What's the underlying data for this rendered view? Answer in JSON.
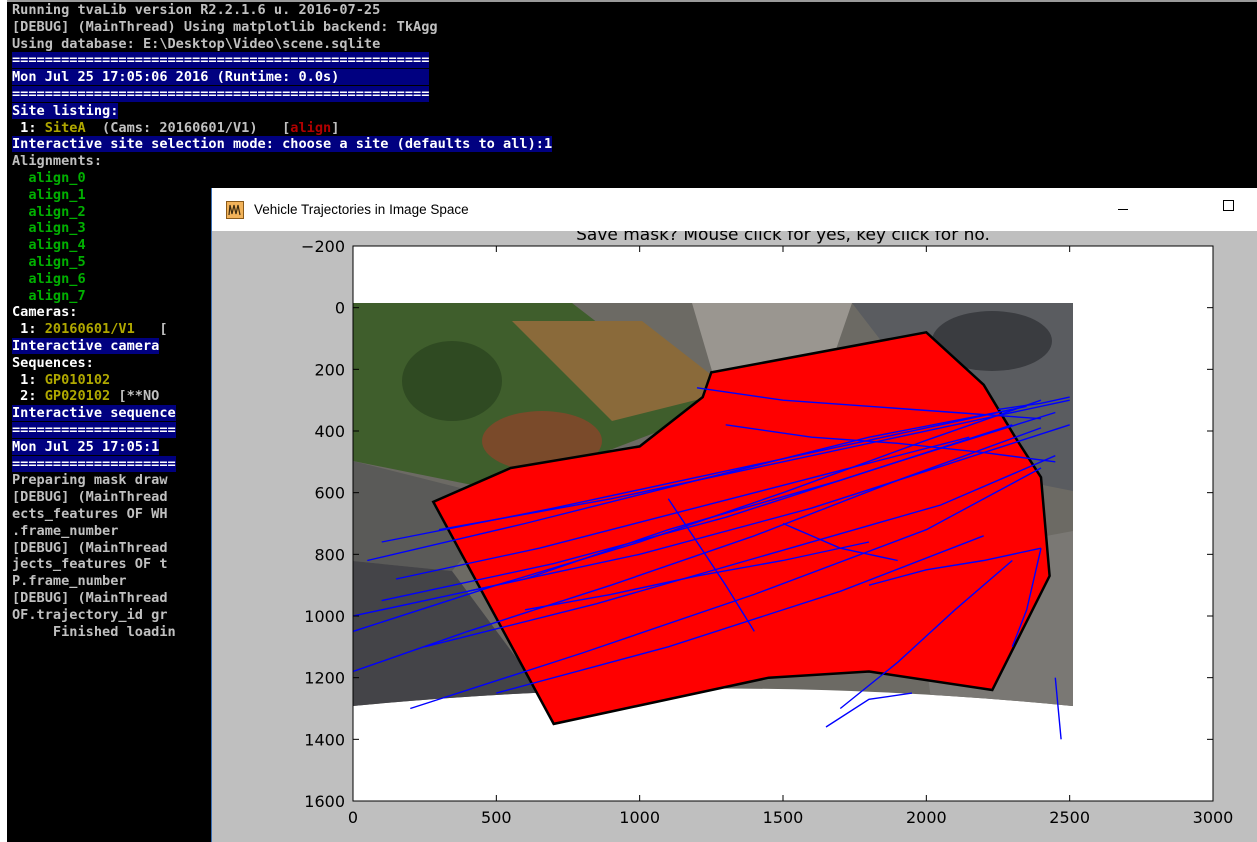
{
  "console": {
    "lines": [
      [
        {
          "t": "Running tvaLib version R2.2.1.6 u. 2016-07-25",
          "c": "gray"
        }
      ],
      [
        {
          "t": "[DEBUG] (MainThread) Using matplotlib backend: TkAgg",
          "c": "gray"
        }
      ],
      [
        {
          "t": "Using database: E:\\Desktop\\Video\\scene.sqlite",
          "c": "gray"
        }
      ],
      [
        {
          "t": "===================================================",
          "c": "white",
          "hl": true
        }
      ],
      [
        {
          "t": "Mon Jul 25 17:05:06 2016 (Runtime: 0.0s)           ",
          "c": "white",
          "hl": true
        }
      ],
      [
        {
          "t": "===================================================",
          "c": "white",
          "hl": true
        }
      ],
      [
        {
          "t": "Site listing:",
          "c": "white",
          "hl": true
        }
      ],
      [
        {
          "t": " 1: ",
          "c": "white"
        },
        {
          "t": "SiteA",
          "c": "olive"
        },
        {
          "t": "  (Cams: 20160601/V1)   [",
          "c": "gray"
        },
        {
          "t": "align",
          "c": "red"
        },
        {
          "t": "]",
          "c": "gray"
        }
      ],
      [
        {
          "t": "Interactive site selection mode: choose a site (defaults to all):1",
          "c": "white",
          "hl": true
        }
      ],
      [
        {
          "t": "Alignments:",
          "c": "gray"
        }
      ],
      [
        {
          "t": "  align_0",
          "c": "green"
        }
      ],
      [
        {
          "t": "  align_1",
          "c": "green"
        }
      ],
      [
        {
          "t": "  align_2",
          "c": "green"
        }
      ],
      [
        {
          "t": "  align_3",
          "c": "green"
        }
      ],
      [
        {
          "t": "  align_4",
          "c": "green"
        }
      ],
      [
        {
          "t": "  align_5",
          "c": "green"
        }
      ],
      [
        {
          "t": "  align_6",
          "c": "green"
        }
      ],
      [
        {
          "t": "  align_7",
          "c": "green"
        }
      ],
      [
        {
          "t": "Cameras:",
          "c": "white"
        }
      ],
      [
        {
          "t": " 1: ",
          "c": "white"
        },
        {
          "t": "20160601/V1",
          "c": "olive"
        },
        {
          "t": "   [",
          "c": "gray"
        }
      ],
      [
        {
          "t": "Interactive camera",
          "c": "white",
          "hl": true
        }
      ],
      [
        {
          "t": "Sequences:",
          "c": "white"
        }
      ],
      [
        {
          "t": " 1: ",
          "c": "white"
        },
        {
          "t": "GP010102",
          "c": "olive"
        }
      ],
      [
        {
          "t": " 2: ",
          "c": "white"
        },
        {
          "t": "GP020102",
          "c": "olive"
        },
        {
          "t": " [**NO",
          "c": "gray"
        }
      ],
      [
        {
          "t": "Interactive sequence",
          "c": "white",
          "hl": true
        }
      ],
      [
        {
          "t": "====================",
          "c": "white",
          "hl": true
        }
      ],
      [
        {
          "t": "Mon Jul 25 17:05:1",
          "c": "white",
          "hl": true
        }
      ],
      [
        {
          "t": "====================",
          "c": "white",
          "hl": true
        }
      ],
      [
        {
          "t": "Preparing mask draw",
          "c": "gray"
        }
      ],
      [
        {
          "t": "[DEBUG] (MainThread",
          "c": "gray"
        }
      ],
      [
        {
          "t": "ects_features OF WH",
          "c": "gray"
        }
      ],
      [
        {
          "t": ".frame_number",
          "c": "gray"
        }
      ],
      [
        {
          "t": "[DEBUG] (MainThread",
          "c": "gray"
        }
      ],
      [
        {
          "t": "jects_features OF t",
          "c": "gray"
        }
      ],
      [
        {
          "t": "P.frame_number",
          "c": "gray"
        }
      ],
      [
        {
          "t": "[DEBUG] (MainThread",
          "c": "gray"
        }
      ],
      [
        {
          "t": "OF.trajectory_id gr",
          "c": "gray"
        }
      ],
      [
        {
          "t": "     Finished loadin",
          "c": "gray"
        }
      ]
    ]
  },
  "colors": {
    "console_bg": "#000000",
    "highlight_bg": "#000080",
    "text_gray": "#c0c0c0",
    "text_white": "#ffffff",
    "text_green": "#00b000",
    "text_olive": "#b0a800",
    "text_red": "#b00000",
    "mask_fill": "#ff0000",
    "trajectory": "#0000ff",
    "figure_bg": "#bfbfbf"
  },
  "window": {
    "title": "Vehicle Trajectories in Image Space",
    "icon": "matplotlib-icon",
    "minimize_icon": "minimize-icon",
    "maximize_icon": "maximize-icon"
  },
  "chart_data": {
    "type": "line",
    "title": "Save mask? Mouse click for yes, key click for no.",
    "xlabel": "",
    "ylabel": "",
    "xlim": [
      0,
      3000
    ],
    "ylim": [
      1600,
      -200
    ],
    "y_inverted": true,
    "x_ticks": [
      0,
      500,
      1000,
      1500,
      2000,
      2500,
      3000
    ],
    "y_ticks": [
      -200,
      0,
      200,
      400,
      600,
      800,
      1000,
      1200,
      1400,
      1600
    ],
    "grid": false,
    "image_extent": [
      0,
      2500,
      1400,
      0
    ],
    "mask_polygon": {
      "x": [
        280,
        700,
        1450,
        1800,
        2230,
        2430,
        2400,
        2310,
        2200,
        2000,
        1250,
        1220,
        1000,
        550
      ],
      "y": [
        630,
        1350,
        1200,
        1180,
        1240,
        870,
        550,
        420,
        250,
        80,
        210,
        290,
        450,
        520
      ]
    },
    "series": [
      {
        "x": [
          0,
          500,
          1000,
          1500,
          2000,
          2400
        ],
        "y": [
          1050,
          900,
          760,
          600,
          430,
          300
        ]
      },
      {
        "x": [
          50,
          600,
          1200,
          1800,
          2300
        ],
        "y": [
          820,
          700,
          560,
          420,
          330
        ]
      },
      {
        "x": [
          100,
          700,
          1300,
          1900,
          2450
        ],
        "y": [
          950,
          830,
          680,
          500,
          340
        ]
      },
      {
        "x": [
          0,
          400,
          900,
          1400,
          1900,
          2400
        ],
        "y": [
          1180,
          1050,
          900,
          740,
          560,
          390
        ]
      },
      {
        "x": [
          200,
          800,
          1400,
          2000,
          2400
        ],
        "y": [
          1300,
          1120,
          930,
          720,
          520
        ]
      },
      {
        "x": [
          300,
          900,
          1500,
          2100,
          2500
        ],
        "y": [
          720,
          620,
          500,
          380,
          300
        ]
      },
      {
        "x": [
          150,
          650,
          1150,
          1650,
          2150
        ],
        "y": [
          880,
          780,
          660,
          540,
          420
        ]
      },
      {
        "x": [
          250,
          850,
          1450,
          2050,
          2450
        ],
        "y": [
          1100,
          960,
          800,
          640,
          480
        ]
      },
      {
        "x": [
          0,
          600,
          1100,
          1700,
          2300
        ],
        "y": [
          1000,
          880,
          720,
          560,
          380
        ]
      },
      {
        "x": [
          400,
          1000,
          1600,
          2200,
          2500
        ],
        "y": [
          920,
          800,
          650,
          470,
          380
        ]
      },
      {
        "x": [
          100,
          700,
          1300,
          1900,
          2350
        ],
        "y": [
          760,
          650,
          530,
          410,
          320
        ]
      },
      {
        "x": [
          500,
          1100,
          1700,
          2200
        ],
        "y": [
          1250,
          1100,
          920,
          740
        ]
      },
      {
        "x": [
          1200,
          1500,
          1800,
          2100,
          2400
        ],
        "y": [
          260,
          300,
          320,
          340,
          360
        ]
      },
      {
        "x": [
          1300,
          1600,
          1900,
          2200,
          2450
        ],
        "y": [
          380,
          420,
          440,
          470,
          500
        ]
      },
      {
        "x": [
          1500,
          1700,
          1900
        ],
        "y": [
          700,
          780,
          820
        ]
      },
      {
        "x": [
          1700,
          1900,
          2100,
          2300
        ],
        "y": [
          1300,
          1150,
          980,
          820
        ]
      },
      {
        "x": [
          2300,
          2350,
          2380,
          2400
        ],
        "y": [
          1100,
          980,
          860,
          780
        ]
      },
      {
        "x": [
          2450,
          2460,
          2470
        ],
        "y": [
          1200,
          1300,
          1400
        ]
      },
      {
        "x": [
          1650,
          1800,
          1950
        ],
        "y": [
          1360,
          1270,
          1250
        ]
      },
      {
        "x": [
          2250,
          2400,
          2500
        ],
        "y": [
          330,
          310,
          290
        ]
      },
      {
        "x": [
          1400,
          1300,
          1200,
          1100
        ],
        "y": [
          1050,
          900,
          760,
          620
        ]
      },
      {
        "x": [
          1800,
          2000,
          2200,
          2400
        ],
        "y": [
          900,
          850,
          820,
          780
        ]
      },
      {
        "x": [
          600,
          900,
          1200,
          1500,
          1800
        ],
        "y": [
          980,
          930,
          870,
          820,
          760
        ]
      }
    ]
  }
}
